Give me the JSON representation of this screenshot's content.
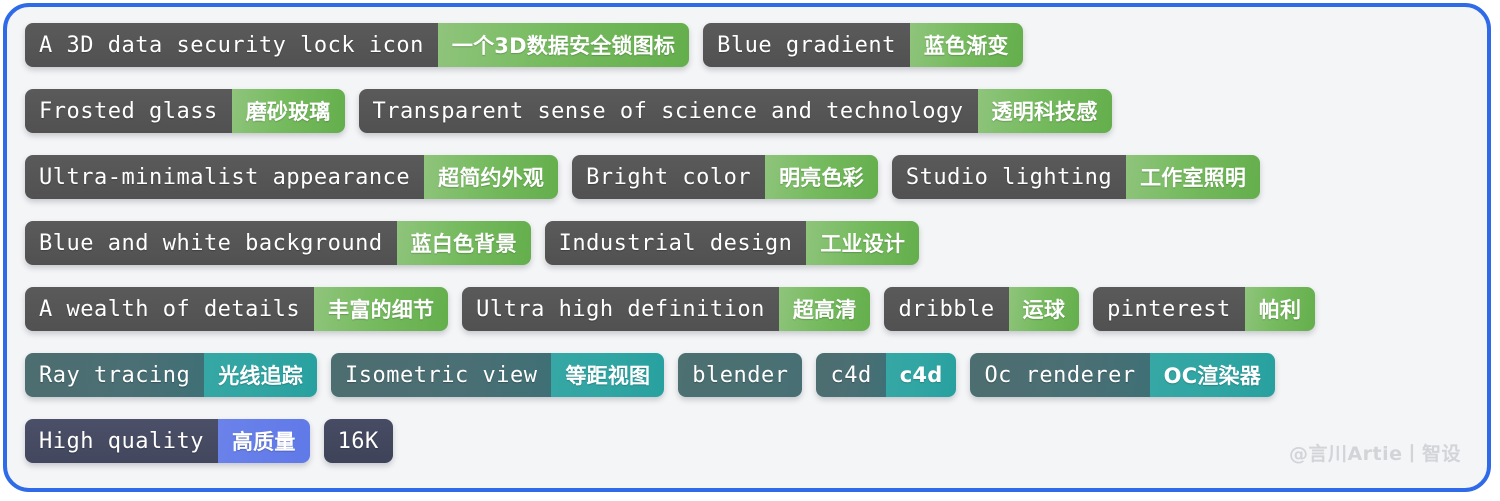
{
  "frame": {
    "border_color": "#2f6ae8",
    "background_color": "#f4f5f7"
  },
  "watermark": {
    "text": "@言川Artie丨智设"
  },
  "themes": {
    "green_en": "#515151",
    "green_zh": "#76bb5f",
    "teal_en": "#4a6f74",
    "teal_zh": "#2fa5a3",
    "indigo_en": "#42475e",
    "indigo_zh": "#5f79e8"
  },
  "rows": [
    {
      "theme": "green",
      "tags": [
        {
          "en": "A 3D data security lock icon",
          "zh": "一个3D数据安全锁图标"
        },
        {
          "en": "Blue gradient",
          "zh": "蓝色渐变"
        }
      ]
    },
    {
      "theme": "green",
      "tags": [
        {
          "en": "Frosted glass",
          "zh": "磨砂玻璃"
        },
        {
          "en": "Transparent sense of science and technology",
          "zh": "透明科技感"
        }
      ]
    },
    {
      "theme": "green",
      "tags": [
        {
          "en": "Ultra-minimalist appearance",
          "zh": "超简约外观"
        },
        {
          "en": "Bright color",
          "zh": "明亮色彩"
        },
        {
          "en": "Studio lighting",
          "zh": "工作室照明"
        }
      ]
    },
    {
      "theme": "green",
      "tags": [
        {
          "en": "Blue and white background",
          "zh": "蓝白色背景"
        },
        {
          "en": "Industrial design",
          "zh": "工业设计"
        }
      ]
    },
    {
      "theme": "green",
      "tags": [
        {
          "en": "A wealth of details",
          "zh": "丰富的细节"
        },
        {
          "en": "Ultra high definition",
          "zh": "超高清"
        },
        {
          "en": "dribble",
          "zh": "运球"
        },
        {
          "en": "pinterest",
          "zh": "帕利"
        }
      ]
    },
    {
      "theme": "teal",
      "tags": [
        {
          "en": "Ray tracing",
          "zh": "光线追踪"
        },
        {
          "en": "Isometric view",
          "zh": "等距视图"
        },
        {
          "en": "blender",
          "zh": ""
        },
        {
          "en": "c4d",
          "zh": "c4d"
        },
        {
          "en": "Oc renderer",
          "zh": "OC渲染器"
        }
      ]
    },
    {
      "theme": "indigo",
      "tags": [
        {
          "en": "High quality",
          "zh": "高质量"
        },
        {
          "en": "16K",
          "zh": ""
        }
      ]
    }
  ]
}
